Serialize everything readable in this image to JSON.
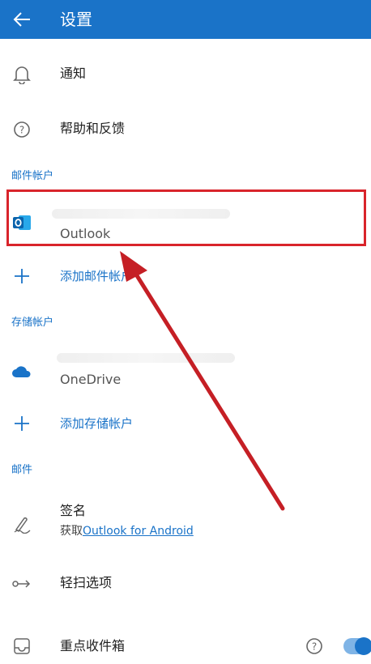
{
  "header": {
    "title": "设置"
  },
  "items": {
    "notifications": "通知",
    "help_feedback": "帮助和反馈"
  },
  "sections": {
    "mail_accounts": "邮件帐户",
    "storage_accounts": "存储帐户",
    "mail": "邮件"
  },
  "mail_account": {
    "provider": "Outlook"
  },
  "add_mail_account": "添加邮件帐户",
  "storage_account": {
    "provider": "OneDrive"
  },
  "add_storage_account": "添加存储帐户",
  "signature": {
    "label": "签名",
    "prefix": "获取",
    "link": "Outlook for Android"
  },
  "swipe_options": "轻扫选项",
  "focused_inbox": "重点收件箱",
  "colors": {
    "accent": "#1a73c8",
    "highlight": "#d9242b"
  }
}
